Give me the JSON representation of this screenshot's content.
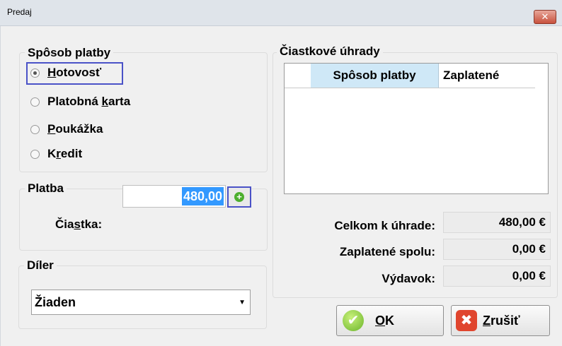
{
  "window": {
    "title": "Predaj"
  },
  "payment_method": {
    "title": "Spôsob platby",
    "options": [
      {
        "pre": "",
        "ul": "H",
        "post": "otovosť",
        "selected": true
      },
      {
        "pre": "Platobná ",
        "ul": "k",
        "post": "arta",
        "selected": false
      },
      {
        "pre": "",
        "ul": "P",
        "post": "oukážka",
        "selected": false
      },
      {
        "pre": "K",
        "ul": "r",
        "post": "edit",
        "selected": false
      }
    ]
  },
  "payment": {
    "title": "Platba",
    "amount_label_pre": "Čia",
    "amount_label_ul": "s",
    "amount_label_post": "tka:",
    "amount_value": "480,00",
    "add_icon": "plus-circle-icon"
  },
  "dealer": {
    "title": "Díler",
    "selected": "Žiaden"
  },
  "partial": {
    "title": "Čiastkové úhrady",
    "columns": [
      "Spôsob platby",
      "Zaplatené"
    ]
  },
  "summary": {
    "total_label": "Celkom k úhrade:",
    "total_value": "480,00 €",
    "paid_label": "Zaplatené spolu:",
    "paid_value": "0,00 €",
    "change_label": "Výdavok:",
    "change_value": "0,00 €"
  },
  "buttons": {
    "ok_ul": "O",
    "ok_post": "K",
    "cancel_ul": "Z",
    "cancel_post": "rušiť"
  },
  "colors": {
    "focus": "#4a52c7",
    "selection": "#3399ff",
    "header_highlight": "#cfe8f7"
  }
}
